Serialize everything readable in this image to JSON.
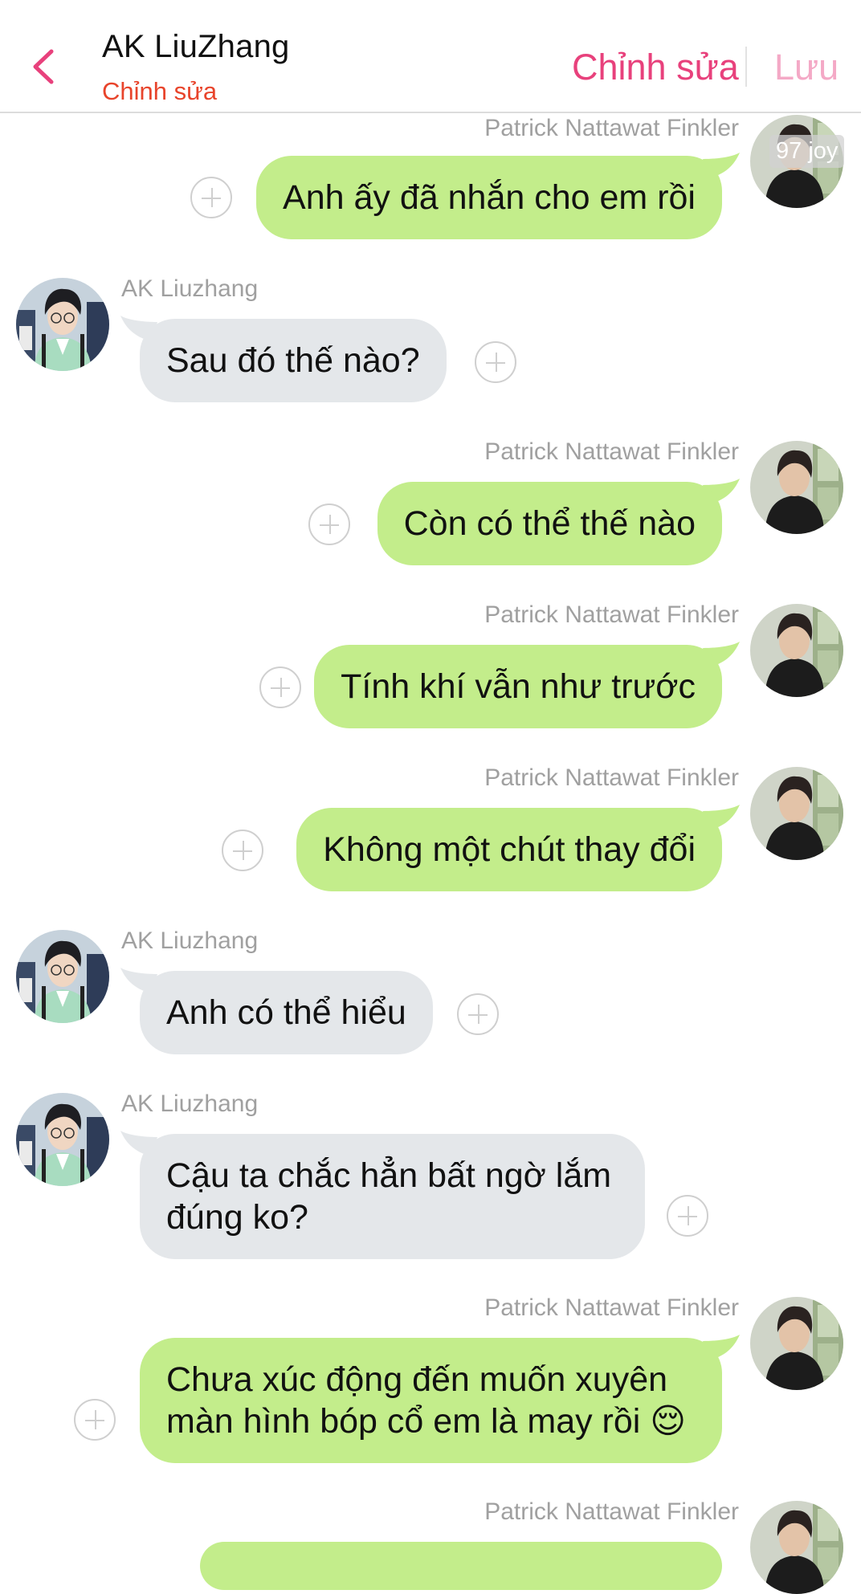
{
  "header": {
    "title": "AK LiuZhang",
    "subtitle": "Chỉnh sửa",
    "edit_label": "Chỉnh sửa",
    "save_label": "Lưu"
  },
  "colors": {
    "accent_pink": "#e8417c",
    "subtitle_red": "#e8442b",
    "save_disabled": "#f4a9c6",
    "bubble_sent": "#c3ed8b",
    "bubble_received": "#e4e7ea"
  },
  "watermark": "97 joy",
  "messages": [
    {
      "sender": "Patrick Nattawat Finkler",
      "side": "right",
      "text": "Anh ấy đã nhắn cho em rồi"
    },
    {
      "sender": "AK Liuzhang",
      "side": "left",
      "text": "Sau đó  thế nào?"
    },
    {
      "sender": "Patrick Nattawat Finkler",
      "side": "right",
      "text": "Còn có thể thế nào"
    },
    {
      "sender": "Patrick Nattawat Finkler",
      "side": "right",
      "text": "Tính khí vẫn như trước"
    },
    {
      "sender": "Patrick Nattawat Finkler",
      "side": "right",
      "text": "Không một chút thay đổi"
    },
    {
      "sender": "AK Liuzhang",
      "side": "left",
      "text": "Anh có thể hiểu"
    },
    {
      "sender": "AK Liuzhang",
      "side": "left",
      "text": "Cậu ta chắc hẳn bất ngờ lắm đúng ko?"
    },
    {
      "sender": "Patrick Nattawat Finkler",
      "side": "right",
      "text": "Chưa xúc động đến muốn xuyên màn hình bóp cổ em là may rồi 😌"
    },
    {
      "sender": "Patrick Nattawat Finkler",
      "side": "right",
      "text": ""
    }
  ]
}
